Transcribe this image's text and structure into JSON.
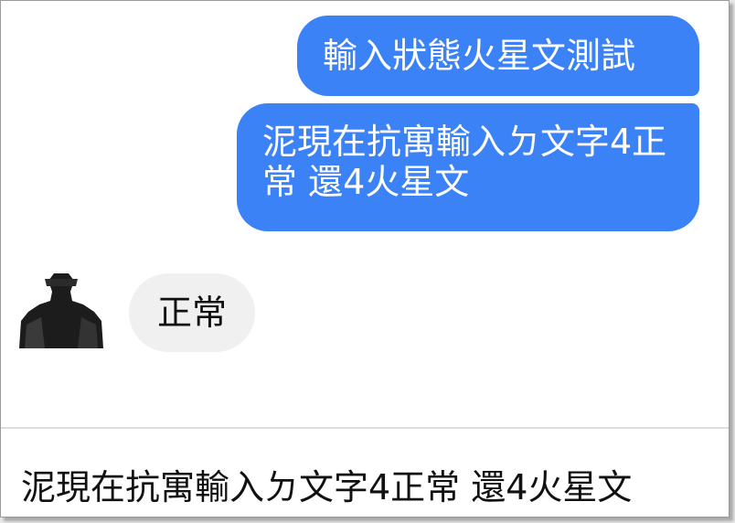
{
  "messages": {
    "outgoing": [
      {
        "text": "輸入狀態火星文測試"
      },
      {
        "text": "泥現在抗寓輸入ㄉ文字4正常 還4火星文"
      }
    ],
    "incoming": [
      {
        "text": "正常"
      }
    ]
  },
  "composer": {
    "value": "泥現在抗寓輸入ㄉ文字4正常 還4火星文"
  },
  "colors": {
    "outgoing_bubble": "#3b82f6",
    "incoming_bubble": "#f0f0f0"
  }
}
